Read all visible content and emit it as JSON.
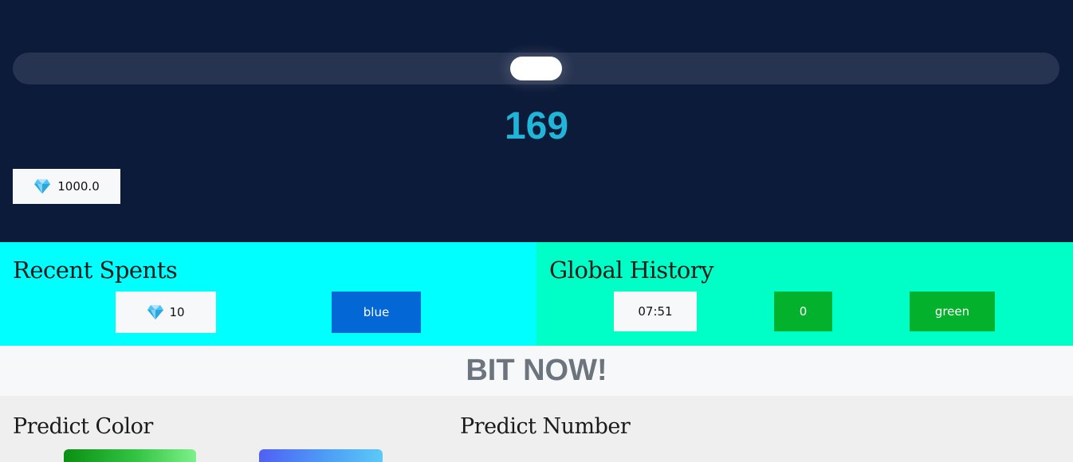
{
  "slider": {
    "value_fraction": 0.5
  },
  "counter": {
    "value": "169"
  },
  "balance": {
    "icon": "gem-icon",
    "amount": "1000.0"
  },
  "recent_spents": {
    "title": "Recent Spents",
    "amount": "10",
    "amount_icon": "gem-icon",
    "color_label": "blue"
  },
  "global_history": {
    "title": "Global History",
    "time": "07:51",
    "number": "0",
    "color_label": "green"
  },
  "banner": {
    "text": "BIT NOW!"
  },
  "predict_color": {
    "title": "Predict Color"
  },
  "predict_number": {
    "title": "Predict Number"
  },
  "colors": {
    "top_bg": "#0d1b3a",
    "accent": "#1fb6d9",
    "recent_bg": "#00ffff",
    "history_bg": "#00ffc6",
    "blue": "#0367d6",
    "green": "#03b12c"
  }
}
